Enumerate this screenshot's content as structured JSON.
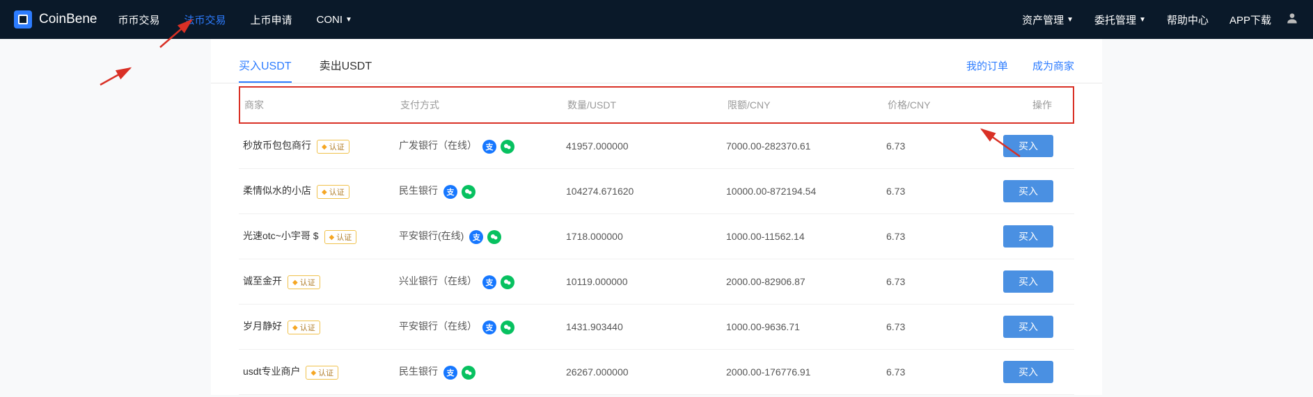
{
  "brand": "CoinBene",
  "nav": {
    "items": [
      {
        "label": "币币交易",
        "active": false
      },
      {
        "label": "法币交易",
        "active": true
      },
      {
        "label": "上币申请",
        "active": false
      },
      {
        "label": "CONI",
        "active": false,
        "dropdown": true
      }
    ],
    "right": [
      {
        "label": "资产管理",
        "dropdown": true
      },
      {
        "label": "委托管理",
        "dropdown": true
      },
      {
        "label": "帮助中心"
      },
      {
        "label": "APP下载"
      }
    ]
  },
  "tabs": {
    "items": [
      {
        "label": "买入USDT",
        "active": true
      },
      {
        "label": "卖出USDT",
        "active": false
      }
    ],
    "links": [
      {
        "label": "我的订单"
      },
      {
        "label": "成为商家"
      }
    ]
  },
  "table": {
    "headers": {
      "merchant": "商家",
      "payment": "支付方式",
      "amount": "数量/USDT",
      "limit": "限额/CNY",
      "price": "价格/CNY",
      "action": "操作"
    },
    "verify_label": "认证",
    "buy_label": "买入",
    "rows": [
      {
        "merchant": "秒放币包包商行",
        "payment": "广发银行（在线）",
        "amount": "41957.000000",
        "limit": "7000.00-282370.61",
        "price": "6.73"
      },
      {
        "merchant": "柔情似水的小店",
        "payment": "民生银行",
        "amount": "104274.671620",
        "limit": "10000.00-872194.54",
        "price": "6.73"
      },
      {
        "merchant": "光速otc~小宇哥 $",
        "payment": "平安银行(在线)",
        "amount": "1718.000000",
        "limit": "1000.00-11562.14",
        "price": "6.73"
      },
      {
        "merchant": "诚至金开",
        "payment": "兴业银行（在线）",
        "amount": "10119.000000",
        "limit": "2000.00-82906.87",
        "price": "6.73"
      },
      {
        "merchant": "岁月静好",
        "payment": "平安银行（在线）",
        "amount": "1431.903440",
        "limit": "1000.00-9636.71",
        "price": "6.73"
      },
      {
        "merchant": "usdt专业商户",
        "payment": "民生银行",
        "amount": "26267.000000",
        "limit": "2000.00-176776.91",
        "price": "6.73"
      }
    ]
  }
}
